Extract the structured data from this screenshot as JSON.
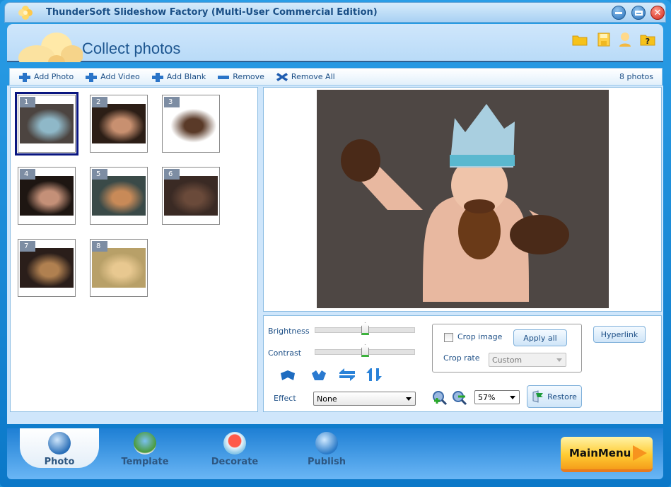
{
  "window": {
    "title": "ThunderSoft Slideshow Factory (Multi-User Commercial Edition)",
    "controls": [
      "minimize",
      "maximize",
      "close"
    ]
  },
  "header": {
    "page_title": "Collect photos",
    "icons": [
      "open-folder-icon",
      "save-icon",
      "user-icon",
      "help-icon"
    ]
  },
  "toolbar": {
    "add_photo": "Add Photo",
    "add_video": "Add Video",
    "add_blank": "Add Blank",
    "remove": "Remove",
    "remove_all": "Remove All",
    "photo_count": "8 photos"
  },
  "thumbnails": [
    {
      "num": "1",
      "selected": true,
      "colors": [
        "#4c4440",
        "#8fb8c8"
      ]
    },
    {
      "num": "2",
      "selected": false,
      "colors": [
        "#2c1e16",
        "#c89070"
      ]
    },
    {
      "num": "3",
      "selected": false,
      "colors": [
        "#ffffff",
        "#5a3a28"
      ]
    },
    {
      "num": "4",
      "selected": false,
      "colors": [
        "#1e1612",
        "#c49078"
      ]
    },
    {
      "num": "5",
      "selected": false,
      "colors": [
        "#3a4a48",
        "#c88a58"
      ]
    },
    {
      "num": "6",
      "selected": false,
      "colors": [
        "#3a2a24",
        "#6a4a3a"
      ]
    },
    {
      "num": "7",
      "selected": false,
      "colors": [
        "#2a1e1a",
        "#b08050"
      ]
    },
    {
      "num": "8",
      "selected": false,
      "colors": [
        "#b8a068",
        "#e8c890"
      ]
    }
  ],
  "controls": {
    "brightness_label": "Brightness",
    "brightness_value": 0.5,
    "contrast_label": "Contrast",
    "contrast_value": 0.5,
    "rotate_buttons": [
      "rotate-left-icon",
      "rotate-right-icon",
      "flip-horizontal-icon",
      "flip-vertical-icon"
    ],
    "effect_label": "Effect",
    "effect_value": "None",
    "crop_image_label": "Crop image",
    "crop_image_checked": false,
    "apply_all_label": "Apply all",
    "crop_rate_label": "Crop rate",
    "crop_rate_value": "Custom",
    "hyperlink_label": "Hyperlink",
    "zoom_value": "57%",
    "restore_label": "Restore"
  },
  "footer": {
    "tabs": [
      {
        "label": "Photo",
        "active": true
      },
      {
        "label": "Template",
        "active": false
      },
      {
        "label": "Decorate",
        "active": false
      },
      {
        "label": "Publish",
        "active": false
      }
    ],
    "main_menu_label": "MainMenu"
  }
}
